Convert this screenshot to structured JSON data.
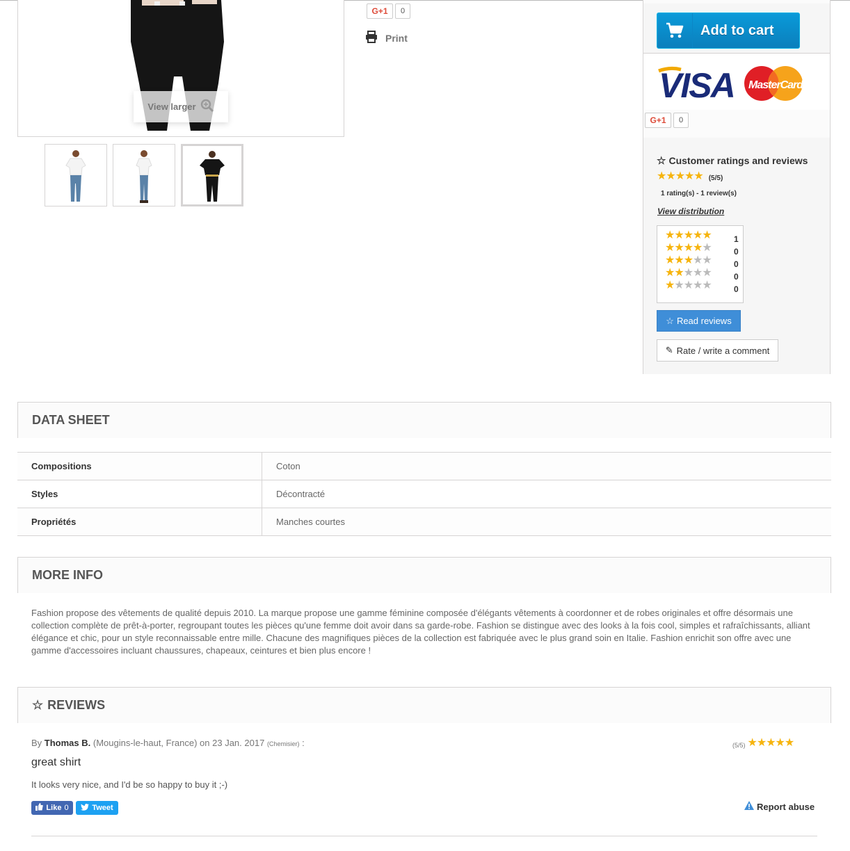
{
  "gallery": {
    "view_larger_label": "View larger",
    "thumbnails": [
      "white top, blue jeans",
      "white top, blue jeans, side",
      "black top, black pants"
    ]
  },
  "social": {
    "gplus_label": "G+1",
    "gplus_count": "0",
    "print_label": "Print"
  },
  "buy_box": {
    "add_to_cart_label": "Add to cart",
    "card_logos": [
      "VISA",
      "MasterCard"
    ],
    "gplus_label": "G+1",
    "gplus_count": "0"
  },
  "ratings": {
    "title": "Customer ratings and reviews",
    "average_stars": 5,
    "score_text": "(5/5)",
    "summary_text": "1 rating(s) - 1 review(s)",
    "view_distribution_label": "View distribution",
    "distribution": [
      {
        "stars": 5,
        "count": "1"
      },
      {
        "stars": 4,
        "count": "0"
      },
      {
        "stars": 3,
        "count": "0"
      },
      {
        "stars": 2,
        "count": "0"
      },
      {
        "stars": 1,
        "count": "0"
      }
    ],
    "read_reviews_label": "Read reviews",
    "rate_label": "Rate / write a comment"
  },
  "data_sheet": {
    "title": "DATA SHEET",
    "rows": [
      {
        "key": "Compositions",
        "value": "Coton"
      },
      {
        "key": "Styles",
        "value": "Décontracté"
      },
      {
        "key": "Propriétés",
        "value": "Manches courtes"
      }
    ]
  },
  "more_info": {
    "title": "MORE INFO",
    "text": "Fashion propose des vêtements de qualité depuis 2010. La marque propose une gamme féminine composée d'élégants vêtements à coordonner et de robes originales et offre désormais une collection complète de prêt-à-porter, regroupant toutes les pièces qu'une femme doit avoir dans sa garde-robe. Fashion se distingue avec des looks à la fois cool, simples et rafraîchissants, alliant élégance et chic, pour un style reconnaissable entre mille. Chacune des magnifiques pièces de la collection est fabriquée avec le plus grand soin en Italie. Fashion enrichit son offre avec une gamme d'accessoires incluant chaussures, chapeaux, ceintures et bien plus encore !"
  },
  "reviews": {
    "title": "REVIEWS",
    "items": [
      {
        "by": "By",
        "author": "Thomas B.",
        "location": "(Mougins-le-haut, France) on 23 Jan. 2017",
        "product": "(Chemisier)",
        "colon": ":",
        "score_text": "(5/5)",
        "stars": 5,
        "title": "great shirt",
        "body": "It looks very nice, and I'd be so happy to buy it ;-)",
        "like_label": "Like",
        "like_count": "0",
        "tweet_label": "Tweet",
        "report_label": "Report abuse"
      }
    ]
  },
  "colors": {
    "accent_blue": "#0b8fd0",
    "star_gold": "#f6b40e",
    "facebook": "#4267b2",
    "twitter": "#1da1f2"
  }
}
